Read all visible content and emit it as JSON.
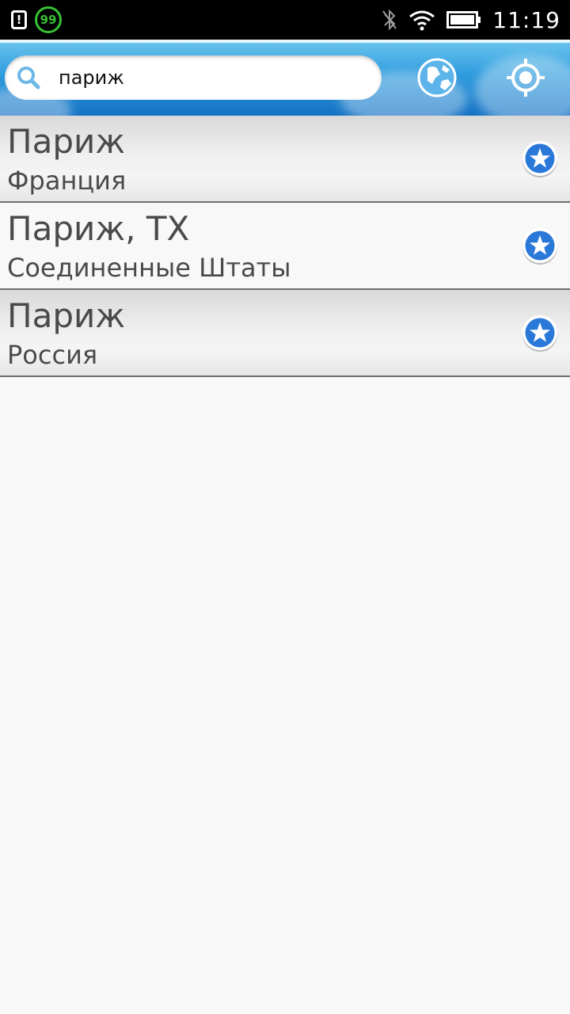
{
  "status_bar": {
    "badge_count": "99",
    "warning_glyph": "!",
    "time": "11:19",
    "icons": [
      "alert-icon",
      "badge-99-icon",
      "bluetooth-off-icon",
      "wifi-icon",
      "battery-icon"
    ]
  },
  "toolbar": {
    "search_value": "париж",
    "search_icon": "search-icon",
    "globe_icon": "globe-icon",
    "locate_icon": "locate-icon"
  },
  "results": [
    {
      "city": "Париж",
      "country": "Франция",
      "icon": "favorite-star-icon"
    },
    {
      "city": "Париж, TX",
      "country": "Соединенные Штаты",
      "icon": "favorite-star-icon"
    },
    {
      "city": "Париж",
      "country": "Россия",
      "icon": "favorite-star-icon"
    }
  ],
  "colors": {
    "toolbar_top": "#6ec6ee",
    "toolbar_bottom": "#1572c4",
    "star_blue": "#2a78d8",
    "badge_green": "#36c236",
    "text_gray": "#4a4a4a"
  }
}
